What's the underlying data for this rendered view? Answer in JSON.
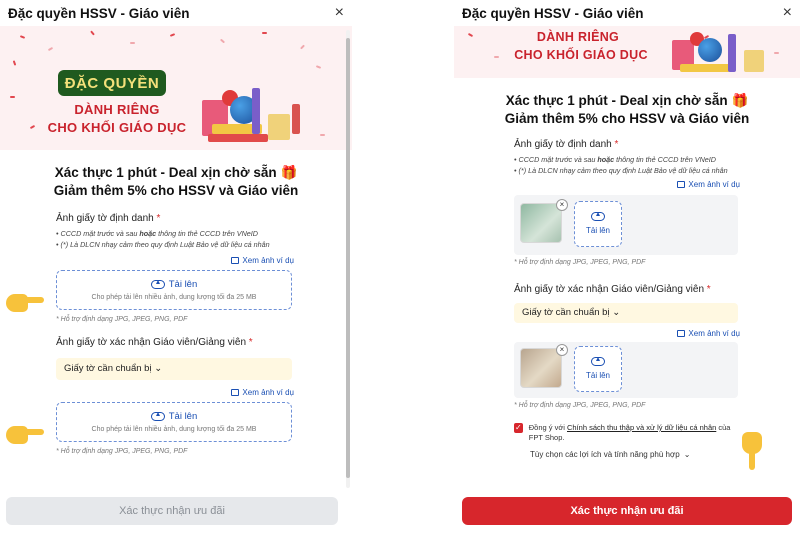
{
  "modal": {
    "title": "Đặc quyền HSSV - Giáo viên",
    "close_glyph": "×"
  },
  "banner": {
    "badge": "ĐẶC QUYỀN",
    "line1": "DÀNH RIÊNG",
    "line2": "CHO KHỐI GIÁO DỤC"
  },
  "headline": {
    "line1": "Xác thực 1 phút - Deal xịn chờ sẵn",
    "gift_icon": "🎁",
    "line2": "Giảm thêm 5% cho HSSV và Giáo viên"
  },
  "id_section": {
    "label": "Ảnh giấy tờ định danh",
    "required": "*",
    "bullet1_pre": "CCCD mặt trước và sau ",
    "bullet1_bold": "hoặc",
    "bullet1_post": " thông tin thẻ CCCD trên VNeID",
    "bullet2": "(*) Là DLCN nhạy cảm theo quy định Luật Bảo vệ dữ liệu cá nhân",
    "example_link": "Xem ảnh ví dụ"
  },
  "upload": {
    "label": "Tải lên",
    "sub": "Cho phép tải lên nhiều ảnh, dung lượng tối đa 25 MB",
    "hint": "* Hỗ trợ định dạng JPG, JPEG, PNG, PDF",
    "remove_glyph": "×"
  },
  "teacher_section": {
    "label": "Ảnh giấy tờ xác nhận Giáo viên/Giảng viên",
    "required": "*",
    "select_value": "Giấy tờ cần chuẩn bị",
    "select_chevron": "⌄",
    "example_link": "Xem ảnh ví dụ"
  },
  "consent": {
    "check_glyph": "✓",
    "pre": "Đồng ý với ",
    "link": "Chính sách thu thập và xử lý dữ liệu cá nhân",
    "post": " của FPT Shop.",
    "options": "Tùy chọn các lợi ích và tính năng phù hợp",
    "options_chevron": "⌄"
  },
  "footer": {
    "submit_label": "Xác thực nhận ưu đãi"
  },
  "colors": {
    "accent_red": "#d7262c",
    "link_blue": "#1a4fb3",
    "banner_green": "#1f5a1f",
    "select_bg": "#fff8e1",
    "disabled_btn": "#e6e8eb"
  }
}
